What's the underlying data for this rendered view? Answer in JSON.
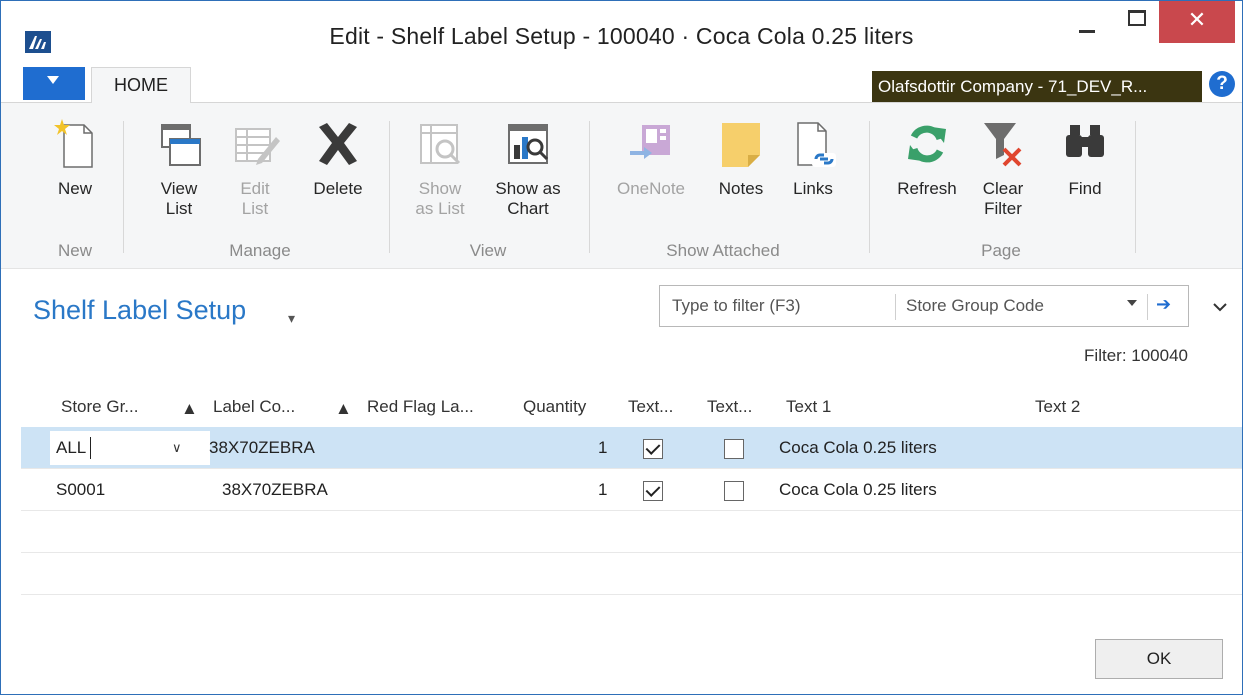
{
  "window": {
    "title": "Edit - Shelf Label Setup - 100040 · Coca Cola 0.25 liters",
    "close_glyph": "✕"
  },
  "ribbon": {
    "tabs": {
      "home": "HOME"
    },
    "company": "Olafsdottir Company - 71_DEV_R...",
    "help_glyph": "?",
    "groups": {
      "new": "New",
      "manage": "Manage",
      "view": "View",
      "show_attached": "Show Attached",
      "page": "Page"
    },
    "buttons": {
      "new": "New",
      "view_list_1": "View",
      "view_list_2": "List",
      "edit_list_1": "Edit",
      "edit_list_2": "List",
      "delete": "Delete",
      "show_as_list_1": "Show",
      "show_as_list_2": "as List",
      "show_as_chart_1": "Show as",
      "show_as_chart_2": "Chart",
      "onenote": "OneNote",
      "notes": "Notes",
      "links": "Links",
      "refresh": "Refresh",
      "clear_filter_1": "Clear",
      "clear_filter_2": "Filter",
      "find": "Find"
    }
  },
  "page": {
    "title": "Shelf Label Setup",
    "title_caret": "▾",
    "filter_placeholder": "Type to filter (F3)",
    "filter_field": "Store Group Code",
    "filter_go": "➔",
    "collapse_glyph": "⌄",
    "filter_text": "Filter: 100040"
  },
  "table": {
    "headers": {
      "store_group": "Store Gr...",
      "label_code": "Label Co...",
      "red_flag": "Red Flag La...",
      "quantity": "Quantity",
      "text_a": "Text...",
      "text_b": "Text...",
      "text1": "Text 1",
      "text2": "Text 2"
    },
    "sort_glyph": "▲",
    "rows": [
      {
        "store_group": "ALL",
        "label_code": "38X70ZEBRA",
        "quantity": "1",
        "text_a": true,
        "text_b": false,
        "text1": "Coca Cola 0.25 liters",
        "text2": ""
      },
      {
        "store_group": "S0001",
        "label_code": "38X70ZEBRA",
        "quantity": "1",
        "text_a": true,
        "text_b": false,
        "text1": "Coca Cola 0.25 liters",
        "text2": ""
      }
    ],
    "dropdown_glyph": "∨"
  },
  "footer": {
    "ok": "OK"
  },
  "colors": {
    "accent": "#1f6dd0",
    "title_blue": "#2a78c7",
    "selected_row": "#cde3f5",
    "company_bg": "#3b3511",
    "close_red": "#c9484d"
  }
}
